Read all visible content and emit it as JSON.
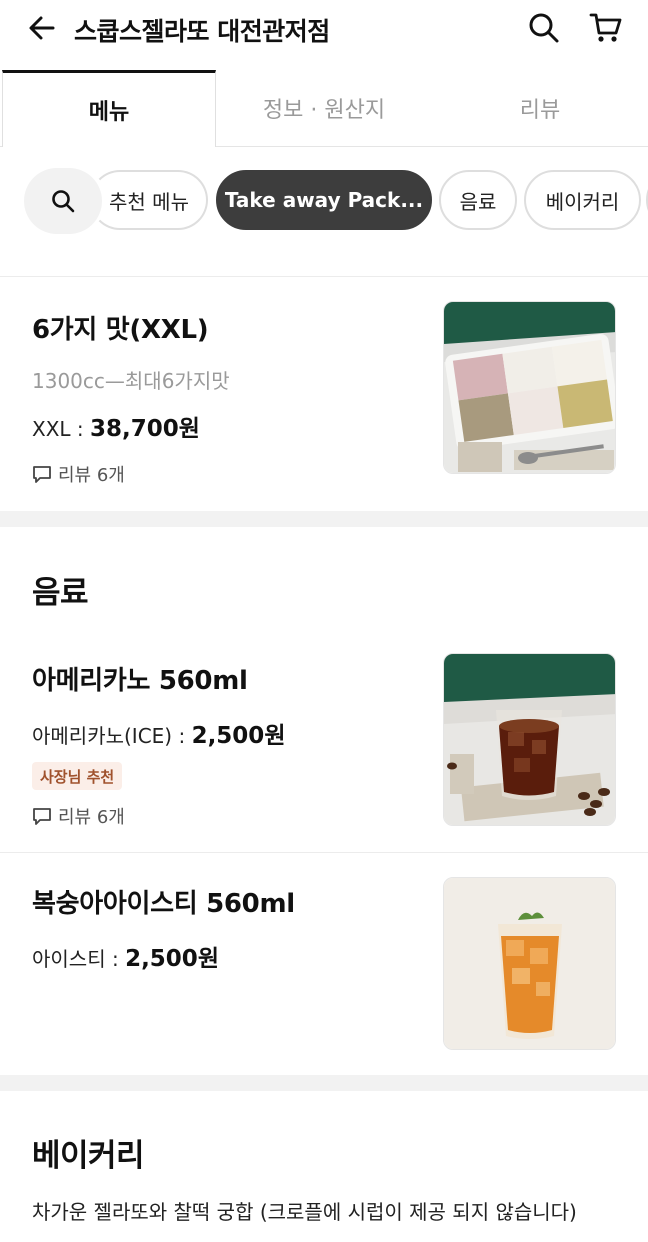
{
  "header": {
    "title": "스쿱스젤라또 대전관저점",
    "icons": [
      "back-arrow-icon",
      "search-icon",
      "cart-icon"
    ]
  },
  "tabs": [
    {
      "label": "메뉴",
      "active": true
    },
    {
      "label": "정보 · 원산지",
      "active": false
    },
    {
      "label": "리뷰",
      "active": false
    }
  ],
  "chips": [
    {
      "label": "추천 메뉴",
      "active": false
    },
    {
      "label": "Take away Pack...",
      "active": true
    },
    {
      "label": "음료",
      "active": false
    },
    {
      "label": "베이커리",
      "active": false
    }
  ],
  "takeaway": {
    "items": [
      {
        "name": "6가지 맛(XXL)",
        "desc": "1300cc—최대6가지맛",
        "price_label": "XXL : ",
        "price": "38,700원",
        "review": "리뷰 6개"
      }
    ]
  },
  "drinks": {
    "title": "음료",
    "items": [
      {
        "name": "아메리카노 560ml",
        "price_label": "아메리카노(ICE) : ",
        "price": "2,500원",
        "badge": "사장님 추천",
        "review": "리뷰 6개"
      },
      {
        "name": "복숭아아이스티 560ml",
        "price_label": "아이스티 : ",
        "price": "2,500원"
      }
    ]
  },
  "bakery": {
    "title": "베이커리",
    "desc": "차가운 젤라또와 찰떡 궁합 (크로플에 시럽이 제공 되지 않습니다)"
  },
  "colors": {
    "active_chip": "#3d3d3d",
    "badge_bg": "#fbeee8",
    "badge_text": "#a0522d",
    "muted_text": "#9a9a9a"
  }
}
